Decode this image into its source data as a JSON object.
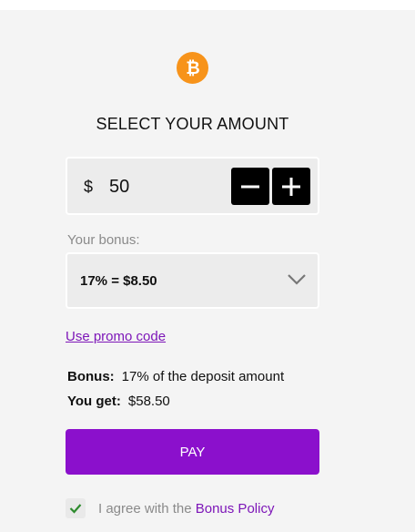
{
  "header": {
    "icon": "bitcoin-icon",
    "title": "SELECT YOUR AMOUNT"
  },
  "amount": {
    "currency_symbol": "$",
    "value": "50",
    "decrement_icon": "minus-icon",
    "increment_icon": "plus-icon"
  },
  "bonus": {
    "label": "Your bonus:",
    "selected": "17% = $8.50",
    "dropdown_icon": "chevron-down-icon"
  },
  "promo": {
    "link_label": "Use promo code"
  },
  "summary": {
    "bonus_label": "Bonus:",
    "bonus_value": "17% of the deposit amount",
    "you_get_label": "You get:",
    "you_get_value": "$58.50"
  },
  "pay": {
    "label": "PAY"
  },
  "agreement": {
    "checked": true,
    "text": "I agree with the",
    "link_label": "Bonus Policy"
  },
  "colors": {
    "accent": "#8b10cc",
    "link": "#7d16b8",
    "bitcoin": "#f7931a",
    "check": "#2e8b2e"
  }
}
